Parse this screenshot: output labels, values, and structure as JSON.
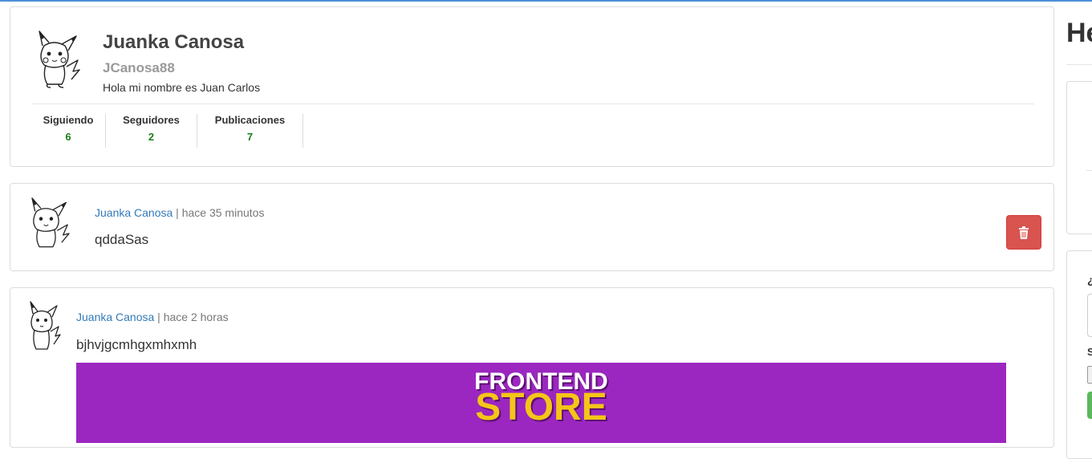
{
  "profile": {
    "name": "Juanka Canosa",
    "username": "JCanosa88",
    "bio": "Hola mi nombre es Juan Carlos",
    "stats": [
      {
        "label": "Siguiendo",
        "value": "6"
      },
      {
        "label": "Seguidores",
        "value": "2"
      },
      {
        "label": "Publicaciones",
        "value": "7"
      }
    ]
  },
  "posts": [
    {
      "author": "Juanka Canosa",
      "separator": " | ",
      "time": "hace 35 minutos",
      "text": "qddaSas",
      "delete_icon": "trash-icon"
    },
    {
      "author": "Juanka Canosa",
      "separator": " | ",
      "time": "hace 2 horas",
      "text": "bjhvjgcmhgxmhxmh",
      "image": {
        "line1": "FRONTEND",
        "line2": "STORE",
        "bg": "#9b27c0",
        "line2_color": "#f5c518"
      }
    }
  ],
  "sidebar": {
    "title": "He",
    "question_label": "¿",
    "file_label": "S"
  },
  "colors": {
    "accent": "#337ab7",
    "danger": "#d9534f",
    "success": "#5cb85c",
    "stat_number": "#1a7f1a"
  }
}
